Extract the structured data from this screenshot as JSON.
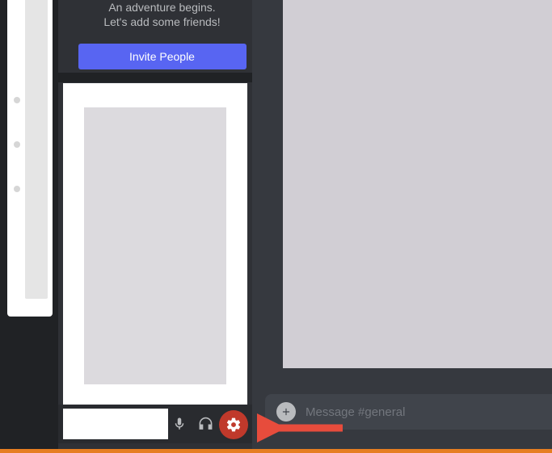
{
  "welcome": {
    "line1": "An adventure begins.",
    "line2": "Let's add some friends!",
    "invite_label": "Invite People"
  },
  "user_panel": {
    "mic_icon": "microphone",
    "headphones_icon": "headphones",
    "settings_icon": "gear"
  },
  "message_bar": {
    "placeholder": "Message #general",
    "add_icon": "plus"
  },
  "colors": {
    "blurple": "#5865f2",
    "highlight_red": "#c0392b",
    "arrow": "#e74c3c"
  }
}
